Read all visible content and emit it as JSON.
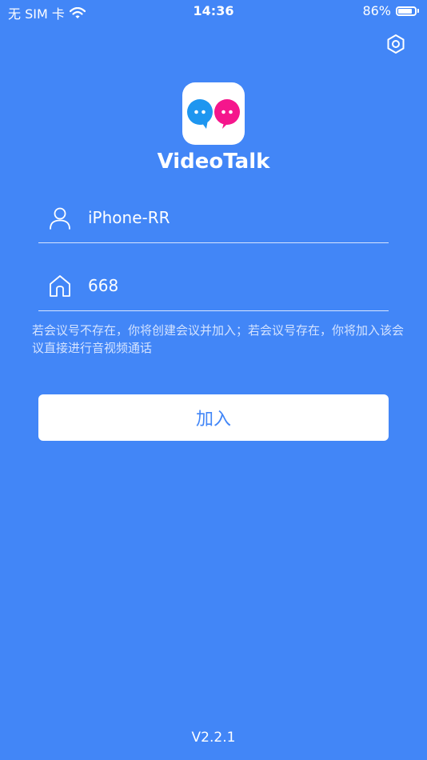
{
  "status_bar": {
    "carrier": "无 SIM 卡",
    "time": "14:36",
    "battery_percent": "86%",
    "battery_level": 0.86
  },
  "app": {
    "name": "VideoTalk",
    "version": "V2.2.1",
    "colors": {
      "background": "#4286f7",
      "bubble_blue": "#1e96f0",
      "bubble_pink": "#f5168c"
    }
  },
  "form": {
    "username": {
      "icon": "person-icon",
      "value": "iPhone-RR"
    },
    "room": {
      "icon": "home-icon",
      "value": "668"
    },
    "hint": "若会议号不存在，你将创建会议并加入；若会议号存在，你将加入该会议直接进行音视频通话",
    "join_label": "加入"
  },
  "toolbar": {
    "settings_icon": "settings-hexagon-icon"
  }
}
